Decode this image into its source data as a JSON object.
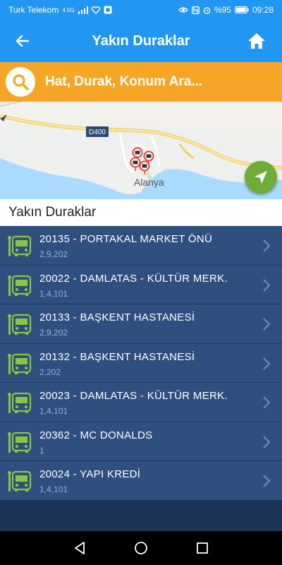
{
  "status_bar": {
    "carrier": "Turk Telekom",
    "network": "4.5G",
    "battery": "%95",
    "time": "09:28"
  },
  "app_bar": {
    "title": "Yakın Duraklar",
    "back_icon": "arrow-left-icon",
    "home_icon": "home-icon"
  },
  "search": {
    "placeholder": "Hat, Durak, Konum Ara..."
  },
  "map": {
    "road_label": "D400",
    "city_label": "Alanya"
  },
  "section_title": "Yakın Duraklar",
  "stops": [
    {
      "name": "20135 - PORTAKAL MARKET ÖNÜ",
      "lines": "2,9,202"
    },
    {
      "name": "20022 - DAMLATAS - KÜLTÜR MERK.",
      "lines": "1,4,101"
    },
    {
      "name": "20133 - BAŞKENT HASTANESİ",
      "lines": "2,9,202"
    },
    {
      "name": "20132 - BAŞKENT HASTANESİ",
      "lines": "2,202"
    },
    {
      "name": "20023 - DAMLATAS - KÜLTÜR MERK.",
      "lines": "1,4,101"
    },
    {
      "name": "20362 - MC DONALDS",
      "lines": "1"
    },
    {
      "name": "20024 - YAPI KREDİ",
      "lines": "1,4,101"
    }
  ],
  "colors": {
    "primary": "#2196f3",
    "accent": "#f7a526",
    "list_bg": "#2f4f7e",
    "bus_icon": "#8cc63f"
  }
}
